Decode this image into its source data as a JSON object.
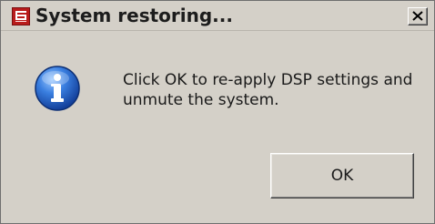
{
  "window": {
    "title": "System restoring...",
    "app_icon": "app-logo-icon",
    "close_icon": "close-icon",
    "close_glyph": "✕"
  },
  "dialog": {
    "icon": "info-icon",
    "message": "Click OK to re-apply DSP settings and unmute the system.",
    "ok_label": "OK"
  },
  "colors": {
    "background": "#d4d0c8",
    "app_icon_red": "#b91c1c",
    "info_blue": "#1f5fbf"
  }
}
